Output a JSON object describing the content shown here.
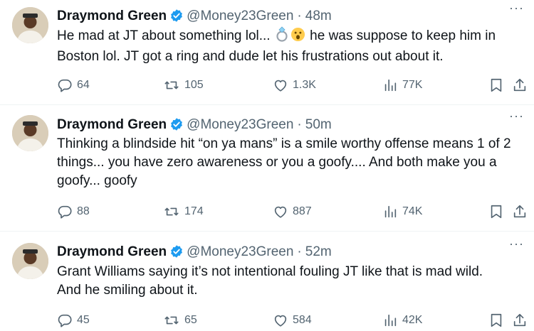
{
  "tweets": [
    {
      "name": "Draymond Green",
      "handle": "@Money23Green",
      "separator": "·",
      "time": "48m",
      "line1_pre": "He mad at JT about something lol...",
      "line1_post": "he was suppose to keep him in",
      "line2": "Boston lol. JT got a ring and dude let his frustrations out about it.",
      "emojis": [
        "ring-emoji",
        "surprised-face-emoji"
      ],
      "replies": "64",
      "retweets": "105",
      "likes": "1.3K",
      "views": "77K"
    },
    {
      "name": "Draymond Green",
      "handle": "@Money23Green",
      "separator": "·",
      "time": "50m",
      "line1": "Thinking a blindside hit “on ya mans” is a smile worthy offense means 1 of 2",
      "line2": "things... you have zero awareness or you a goofy.... And both make you a",
      "line3": "goofy... goofy",
      "replies": "88",
      "retweets": "174",
      "likes": "887",
      "views": "74K"
    },
    {
      "name": "Draymond Green",
      "handle": "@Money23Green",
      "separator": "·",
      "time": "52m",
      "line1": "Grant Williams saying it’s not intentional fouling JT like that is mad wild.",
      "line2": "And he smiling about it.",
      "replies": "45",
      "retweets": "65",
      "likes": "584",
      "views": "42K"
    }
  ],
  "more_label": "···",
  "colors": {
    "verified": "#1d9bf0",
    "muted": "#536471",
    "text": "#0f1419",
    "divider": "#eff3f4"
  },
  "icons": [
    "verified-badge-icon",
    "reply-icon",
    "retweet-icon",
    "like-icon",
    "views-icon",
    "bookmark-icon",
    "share-icon"
  ]
}
